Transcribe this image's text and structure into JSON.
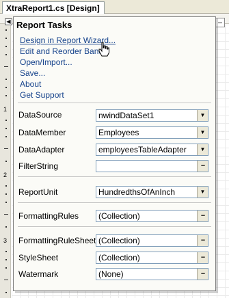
{
  "document": {
    "tab_title": "XtraReport1.cs [Design]"
  },
  "ruler": {
    "marks": [
      "1",
      "2",
      "3"
    ]
  },
  "panel": {
    "title": "Report Tasks",
    "links": [
      "Design in Report Wizard...",
      "Edit and Reorder Bands",
      "Open/Import...",
      "Save...",
      "About",
      "Get Support"
    ],
    "properties": {
      "data_source": {
        "label": "DataSource",
        "value": "nwindDataSet1",
        "control": "dropdown"
      },
      "data_member": {
        "label": "DataMember",
        "value": "Employees",
        "control": "dropdown"
      },
      "data_adapter": {
        "label": "DataAdapter",
        "value": "employeesTableAdapter",
        "control": "dropdown"
      },
      "filter_string": {
        "label": "FilterString",
        "value": "",
        "control": "ellipsis"
      },
      "report_unit": {
        "label": "ReportUnit",
        "value": "HundredthsOfAnInch",
        "control": "dropdown"
      },
      "formatting_rules": {
        "label": "FormattingRules",
        "value": "(Collection)",
        "control": "ellipsis"
      },
      "formatting_rule_sheet": {
        "label": "FormattingRuleSheet",
        "value": "(Collection)",
        "control": "ellipsis"
      },
      "style_sheet": {
        "label": "StyleSheet",
        "value": "(Collection)",
        "control": "ellipsis"
      },
      "watermark": {
        "label": "Watermark",
        "value": "(None)",
        "control": "ellipsis"
      }
    },
    "hovered_link": "Design in Report Wizard..."
  },
  "colors": {
    "link": "#15428b",
    "panel_bg": "#fbfbf7",
    "tabstrip_bg": "#ece9d8"
  }
}
